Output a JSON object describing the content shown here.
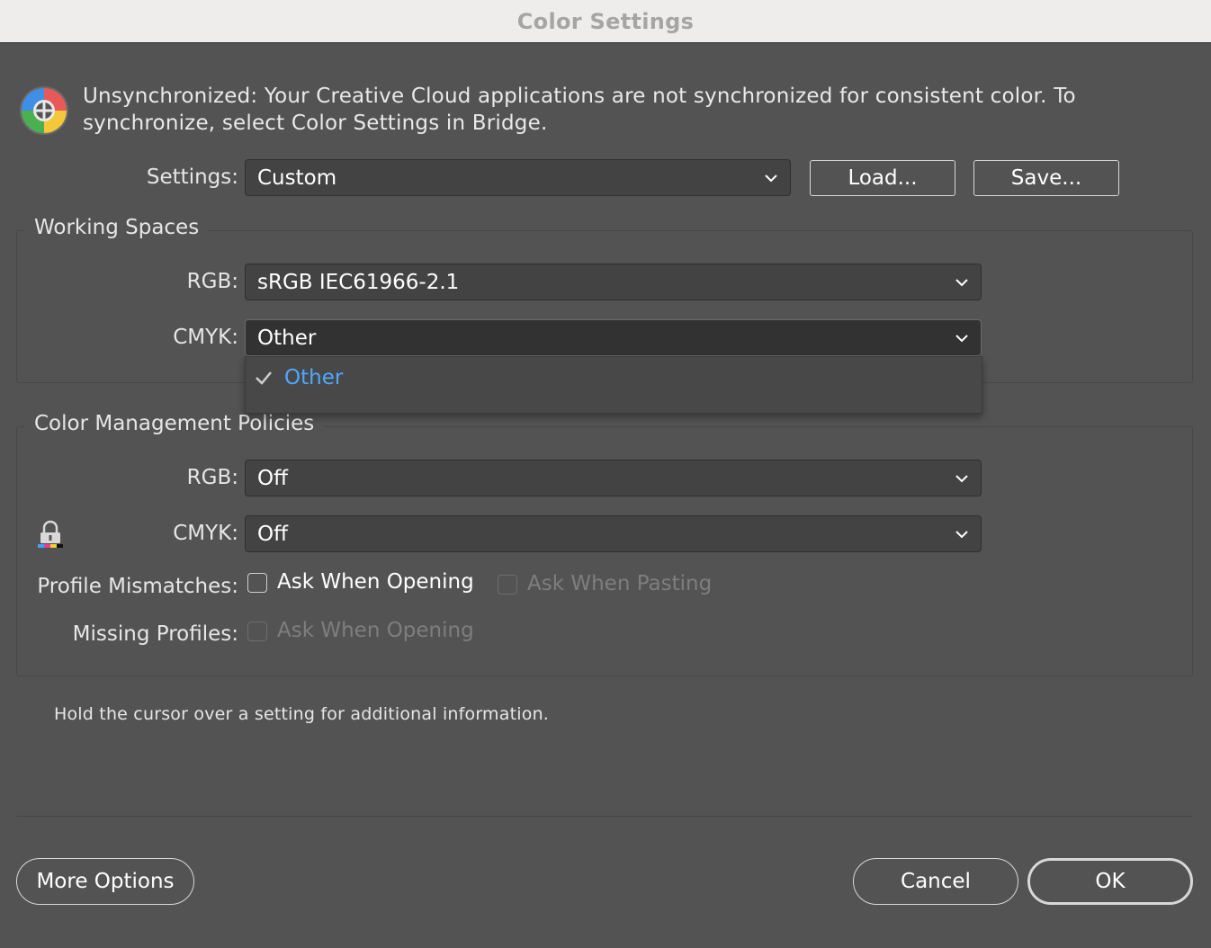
{
  "window": {
    "title": "Color Settings"
  },
  "sync": {
    "icon": "color-wheel-icon",
    "message": "Unsynchronized: Your Creative Cloud applications are not synchronized for consistent color. To synchronize, select Color Settings in Bridge."
  },
  "settings": {
    "label": "Settings:",
    "value": "Custom",
    "load_label": "Load...",
    "save_label": "Save..."
  },
  "working_spaces": {
    "title": "Working Spaces",
    "rgb_label": "RGB:",
    "rgb_value": "sRGB IEC61966-2.1",
    "cmyk_label": "CMYK:",
    "cmyk_value": "Other",
    "cmyk_menu": {
      "items": [
        {
          "label": "Other",
          "checked": true
        }
      ]
    }
  },
  "policies": {
    "title": "Color Management Policies",
    "rgb_label": "RGB:",
    "rgb_value": "Off",
    "cmyk_label": "CMYK:",
    "cmyk_value": "Off",
    "lock_icon": "lock-icon",
    "profile_mismatches": {
      "label": "Profile Mismatches:",
      "ask_opening": {
        "label": "Ask When Opening",
        "checked": false,
        "enabled": true
      },
      "ask_pasting": {
        "label": "Ask When Pasting",
        "checked": false,
        "enabled": false
      }
    },
    "missing_profiles": {
      "label": "Missing Profiles:",
      "ask_opening": {
        "label": "Ask When Opening",
        "checked": false,
        "enabled": false
      }
    }
  },
  "info_text": "Hold the cursor over a setting for additional information.",
  "footer": {
    "more_options_label": "More Options",
    "cancel_label": "Cancel",
    "ok_label": "OK"
  },
  "colors": {
    "dialog_background": "#535353",
    "titlebar_background": "#efecec",
    "menu_highlight": "#4fa8ff"
  }
}
